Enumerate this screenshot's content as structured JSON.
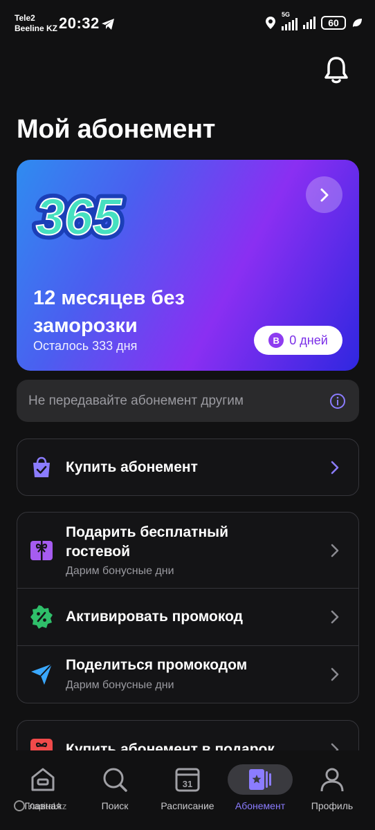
{
  "status_bar": {
    "carrier_1": "Tele2",
    "carrier_2": "Beeline KZ",
    "time": "20:32",
    "network": "5G",
    "battery": "60"
  },
  "header": {
    "notifications_icon": "bell-icon"
  },
  "page_title": "Мой абонемент",
  "subscription_card": {
    "logo_text": "365",
    "title": "12 месяцев без заморозки",
    "remaining": "Осталось 333 дня",
    "days_badge_letter": "В",
    "days_badge": "0 дней",
    "gradient": [
      "#2f8cf0",
      "#8a2ff2",
      "#2f27e0"
    ]
  },
  "notice": {
    "text": "Не передавайте абонемент другим",
    "icon": "info-icon"
  },
  "menu": {
    "buy": {
      "label": "Купить абонемент",
      "icon": "shopping-bag-icon"
    },
    "gift_guest": {
      "label": "Подарить бесплатный гостевой",
      "sub": "Дарим бонусные дни",
      "icon": "gift-icon"
    },
    "activate_promo": {
      "label": "Активировать промокод",
      "icon": "percent-badge-icon"
    },
    "share_promo": {
      "label": "Поделиться промокодом",
      "sub": "Дарим бонусные дни",
      "icon": "send-icon"
    },
    "buy_gift": {
      "label": "Купить абонемент в подарок",
      "icon": "gift-box-icon"
    }
  },
  "bottom_nav": [
    {
      "label": "Главная",
      "icon": "home-icon"
    },
    {
      "label": "Поиск",
      "icon": "search-icon"
    },
    {
      "label": "Расписание",
      "icon": "calendar-icon",
      "day": "31"
    },
    {
      "label": "Абонемент",
      "icon": "membership-card-icon",
      "active": true
    },
    {
      "label": "Профиль",
      "icon": "user-icon"
    }
  ],
  "watermark": "Kapital.kz",
  "colors": {
    "accent": "#8b7cff",
    "background": "#111112",
    "card_border": "#35353a"
  }
}
